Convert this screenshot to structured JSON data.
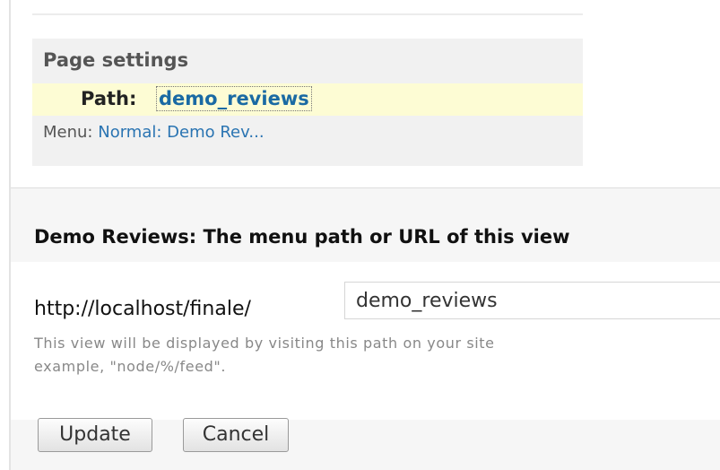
{
  "page_settings": {
    "title": "Page settings",
    "path_label": "Path:",
    "path_value": "demo_reviews",
    "menu_label": "Menu:",
    "menu_value": "Normal: Demo Rev..."
  },
  "path_form": {
    "title": "Demo Reviews: The menu path or URL of this view",
    "url_prefix": "http://localhost/finale/",
    "path_input_value": "demo_reviews",
    "help_line_1": "This view will be displayed by visiting this path on your site",
    "help_line_2": "example, \"node/%/feed\"."
  },
  "buttons": {
    "update": "Update",
    "cancel": "Cancel"
  }
}
